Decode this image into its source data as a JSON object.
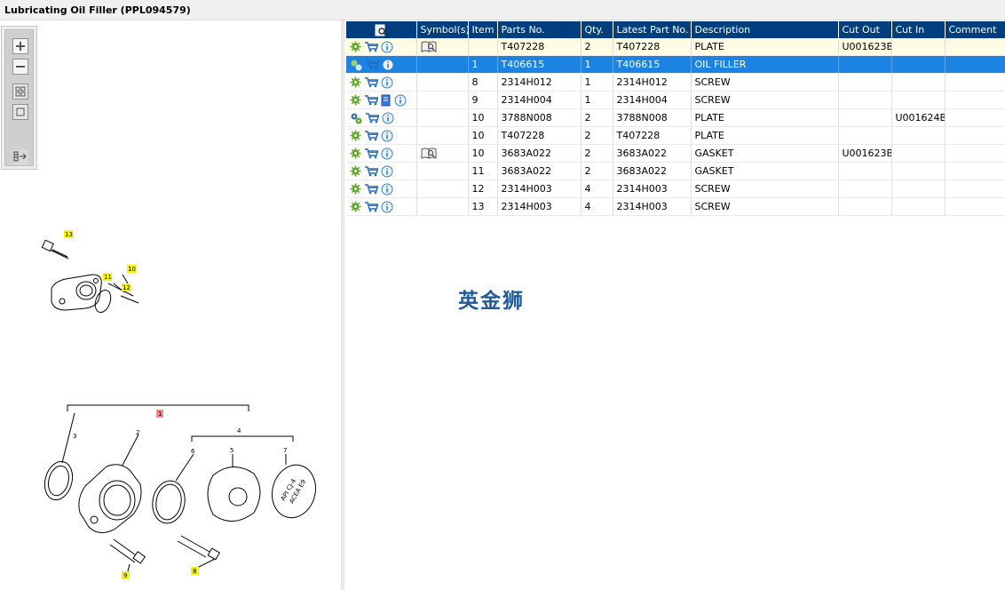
{
  "window": {
    "title": "Lubricating Oil Filler (PPL094579)"
  },
  "toolbar": {
    "buttons": [
      {
        "name": "zoom-in",
        "icon": "plus-icon"
      },
      {
        "name": "zoom-out",
        "icon": "minus-icon"
      },
      {
        "name": "fit-all",
        "icon": "grid-icon"
      },
      {
        "name": "fit-page",
        "icon": "square-icon"
      },
      {
        "name": "layout",
        "icon": "panel-arrow-icon"
      }
    ]
  },
  "drawing": {
    "callouts_upper": [
      "13",
      "11",
      "10",
      "12"
    ],
    "callouts_lower_highlight": [
      "1",
      "9",
      "8"
    ],
    "callouts_lower_numbers": [
      "3",
      "2",
      "4",
      "6",
      "5",
      "7"
    ],
    "oil_cap_text": [
      "API CJ-4",
      "ACEA E9"
    ]
  },
  "table": {
    "columns": [
      "",
      "Symbol(s)",
      "Item",
      "Parts No.",
      "Qty.",
      "Latest Part No.",
      "Description",
      "Cut Out",
      "Cut In",
      "Comment"
    ],
    "rows": [
      {
        "symbol": "book",
        "item": "",
        "part": "T407228",
        "qty": "2",
        "latest": "T407228",
        "desc": "PLATE",
        "cutout": "U001623B",
        "cutin": "",
        "comment": ""
      },
      {
        "symbol": "",
        "item": "1",
        "part": "T406615",
        "qty": "1",
        "latest": "T406615",
        "desc": "OIL FILLER",
        "cutout": "",
        "cutin": "",
        "comment": ""
      },
      {
        "symbol": "",
        "item": "8",
        "part": "2314H012",
        "qty": "1",
        "latest": "2314H012",
        "desc": "SCREW",
        "cutout": "",
        "cutin": "",
        "comment": ""
      },
      {
        "symbol": "",
        "item": "9",
        "part": "2314H004",
        "qty": "1",
        "latest": "2314H004",
        "desc": "SCREW",
        "cutout": "",
        "cutin": "",
        "comment": ""
      },
      {
        "symbol": "",
        "item": "10",
        "part": "3788N008",
        "qty": "2",
        "latest": "3788N008",
        "desc": "PLATE",
        "cutout": "",
        "cutin": "U001624B",
        "comment": ""
      },
      {
        "symbol": "",
        "item": "10",
        "part": "T407228",
        "qty": "2",
        "latest": "T407228",
        "desc": "PLATE",
        "cutout": "",
        "cutin": "",
        "comment": ""
      },
      {
        "symbol": "book",
        "item": "10",
        "part": "3683A022",
        "qty": "2",
        "latest": "3683A022",
        "desc": "GASKET",
        "cutout": "U001623B",
        "cutin": "",
        "comment": ""
      },
      {
        "symbol": "",
        "item": "11",
        "part": "3683A022",
        "qty": "2",
        "latest": "3683A022",
        "desc": "GASKET",
        "cutout": "",
        "cutin": "",
        "comment": ""
      },
      {
        "symbol": "",
        "item": "12",
        "part": "2314H003",
        "qty": "4",
        "latest": "2314H003",
        "desc": "SCREW",
        "cutout": "",
        "cutin": "",
        "comment": ""
      },
      {
        "symbol": "",
        "item": "13",
        "part": "2314H003",
        "qty": "4",
        "latest": "2314H003",
        "desc": "SCREW",
        "cutout": "",
        "cutin": "",
        "comment": ""
      }
    ]
  },
  "watermark": "英金狮",
  "colors": {
    "header_bg": "#003e7e",
    "selected_row": "#1c83e2",
    "highlight_row": "#fefde4",
    "callout_yellow": "#f6f600",
    "callout_red": "#f48a8a"
  }
}
